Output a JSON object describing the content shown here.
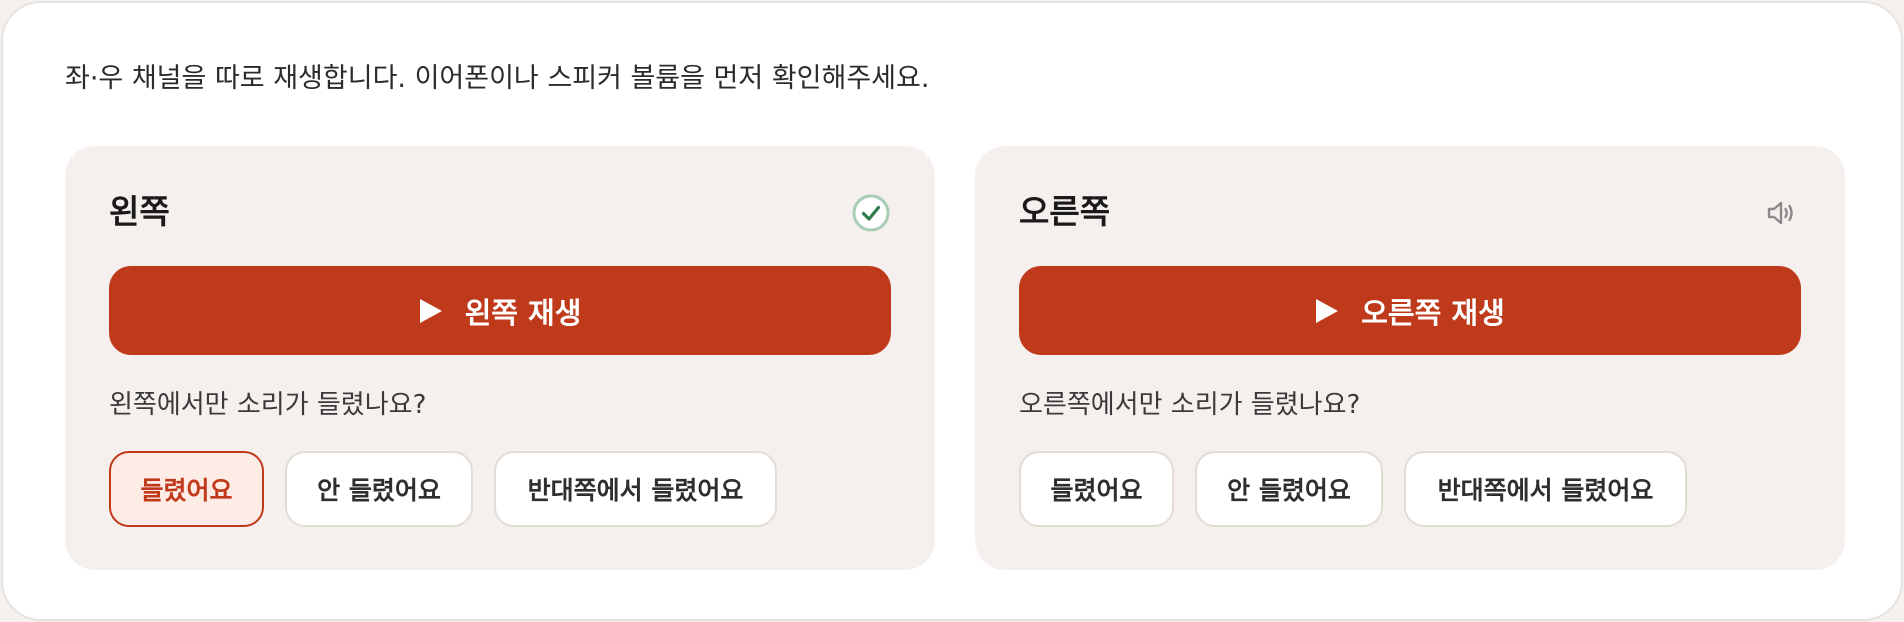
{
  "instruction": "좌·우 채널을 따로 재생합니다. 이어폰이나 스피커 볼륨을 먼저 확인해주세요.",
  "colors": {
    "accent": "#bf3a1b",
    "panel_bg": "#f5f0ed",
    "selected_bg": "#fdebe6",
    "check_green": "#2e7d4a"
  },
  "left": {
    "title": "왼쪽",
    "status_icon": "check-circle-icon",
    "play_label": "왼쪽 재생",
    "question": "왼쪽에서만 소리가 들렸나요?",
    "answers": [
      "들렸어요",
      "안 들렸어요",
      "반대쪽에서 들렸어요"
    ],
    "selected": "들렸어요"
  },
  "right": {
    "title": "오른쪽",
    "status_icon": "speaker-icon",
    "play_label": "오른쪽 재생",
    "question": "오른쪽에서만 소리가 들렸나요?",
    "answers": [
      "들렸어요",
      "안 들렸어요",
      "반대쪽에서 들렸어요"
    ],
    "selected": null
  }
}
